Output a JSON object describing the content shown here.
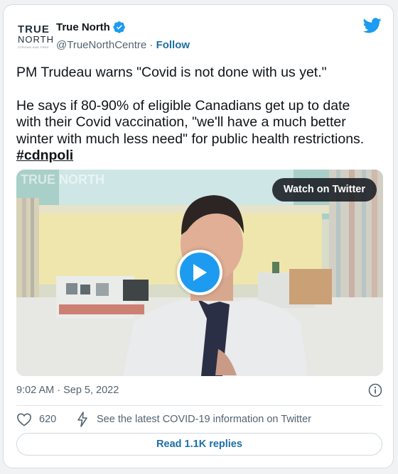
{
  "author": {
    "avatar_line1": "TRUE",
    "avatar_line2": "NORTH",
    "avatar_line3": "STRONG AND FREE",
    "name": "True North",
    "handle": "@TrueNorthCentre",
    "separator": "·",
    "follow_label": "Follow",
    "verified_icon": "verified-badge-icon"
  },
  "tweet": {
    "para1": "PM Trudeau warns \"Covid is not done with us yet.\"",
    "para2_line1": "He says if 80-90% of eligible Canadians get up to date",
    "para2_line2": "with their Covid vaccination, \"we'll have a much better",
    "para2_line3": "winter with much less need\" for public health restrictions.",
    "hashtag": "#cdnpoli"
  },
  "media": {
    "watermark": "TRUE NORTH",
    "watch_label": "Watch on Twitter",
    "play_icon": "play-icon"
  },
  "meta": {
    "timestamp": "9:02 AM · Sep 5, 2022",
    "info_icon": "info-icon"
  },
  "actions": {
    "like_count": "620",
    "covid_label": "See the latest COVID-19 information on Twitter",
    "replies_label": "Read 1.1K replies"
  },
  "colors": {
    "accent": "#1d9bf0",
    "link": "#1d6fa5",
    "text": "#0f1419",
    "muted": "#536471"
  }
}
